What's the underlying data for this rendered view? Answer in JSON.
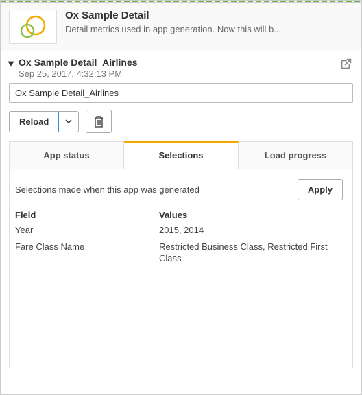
{
  "header": {
    "title": "Ox Sample Detail",
    "description": "Detail metrics used in app generation. Now this will b..."
  },
  "detail": {
    "name": "Ox Sample Detail_Airlines",
    "timestamp": "Sep 25, 2017, 4:32:13 PM",
    "input_value": "Ox Sample Detail_Airlines"
  },
  "toolbar": {
    "reload_label": "Reload"
  },
  "tabs": [
    {
      "label": "App status"
    },
    {
      "label": "Selections"
    },
    {
      "label": "Load progress"
    }
  ],
  "active_tab": 1,
  "selections": {
    "description": "Selections made when this app was generated",
    "apply_label": "Apply",
    "field_header": "Field",
    "values_header": "Values",
    "rows": [
      {
        "field": "Year",
        "values": "2015, 2014"
      },
      {
        "field": "Fare Class Name",
        "values": "Restricted Business Class, Restricted First Class"
      }
    ]
  }
}
